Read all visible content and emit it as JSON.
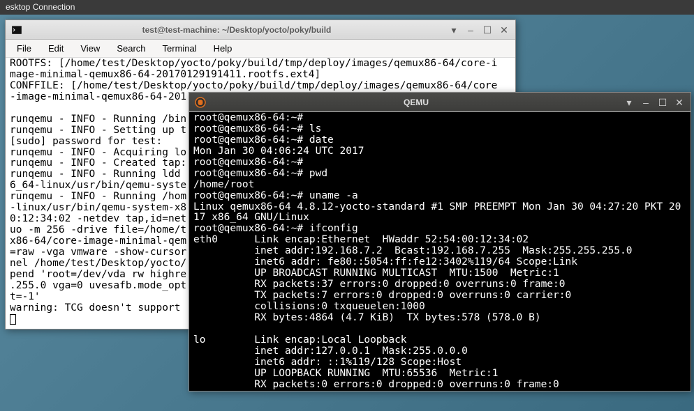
{
  "desktop": {
    "header": "esktop Connection"
  },
  "window_main": {
    "title": "test@test-machine: ~/Desktop/yocto/poky/build",
    "menu": {
      "file": "File",
      "edit": "Edit",
      "view": "View",
      "search": "Search",
      "terminal": "Terminal",
      "help": "Help"
    },
    "content": "ROOTFS: [/home/test/Desktop/yocto/poky/build/tmp/deploy/images/qemux86-64/core-i\nmage-minimal-qemux86-64-20170129191411.rootfs.ext4]\nCONFFILE: [/home/test/Desktop/yocto/poky/build/tmp/deploy/images/qemux86-64/core\n-image-minimal-qemux86-64-201\n\nrunqemu - INFO - Running /bin\nrunqemu - INFO - Setting up t\n[sudo] password for test:\nrunqemu - INFO - Acquiring lo\nrunqemu - INFO - Created tap:\nrunqemu - INFO - Running ldd \n6_64-linux/usr/bin/qemu-syste\nrunqemu - INFO - Running /hom\n-linux/usr/bin/qemu-system-x8\n0:12:34:02 -netdev tap,id=net\nuo -m 256 -drive file=/home/t\nx86-64/core-image-minimal-qem\n=raw -vga vmware -show-cursor\nnel /home/test/Desktop/yocto/\npend 'root=/dev/vda rw highre\n.255.0 vga=0 uvesafb.mode_opt\nt=-1'\nwarning: TCG doesn't support "
  },
  "window_qemu": {
    "title": "QEMU",
    "content": "root@qemux86-64:~#\nroot@qemux86-64:~# ls\nroot@qemux86-64:~# date\nMon Jan 30 04:06:24 UTC 2017\nroot@qemux86-64:~#\nroot@qemux86-64:~# pwd\n/home/root\nroot@qemux86-64:~# uname -a\nLinux qemux86-64 4.8.12-yocto-standard #1 SMP PREEMPT Mon Jan 30 04:27:20 PKT 20\n17 x86_64 GNU/Linux\nroot@qemux86-64:~# ifconfig\neth0      Link encap:Ethernet  HWaddr 52:54:00:12:34:02\n          inet addr:192.168.7.2  Bcast:192.168.7.255  Mask:255.255.255.0\n          inet6 addr: fe80::5054:ff:fe12:3402%119/64 Scope:Link\n          UP BROADCAST RUNNING MULTICAST  MTU:1500  Metric:1\n          RX packets:37 errors:0 dropped:0 overruns:0 frame:0\n          TX packets:7 errors:0 dropped:0 overruns:0 carrier:0\n          collisions:0 txqueuelen:1000\n          RX bytes:4864 (4.7 KiB)  TX bytes:578 (578.0 B)\n\nlo        Link encap:Local Loopback\n          inet addr:127.0.0.1  Mask:255.0.0.0\n          inet6 addr: ::1%119/128 Scope:Host\n          UP LOOPBACK RUNNING  MTU:65536  Metric:1\n          RX packets:0 errors:0 dropped:0 overruns:0 frame:0"
  }
}
